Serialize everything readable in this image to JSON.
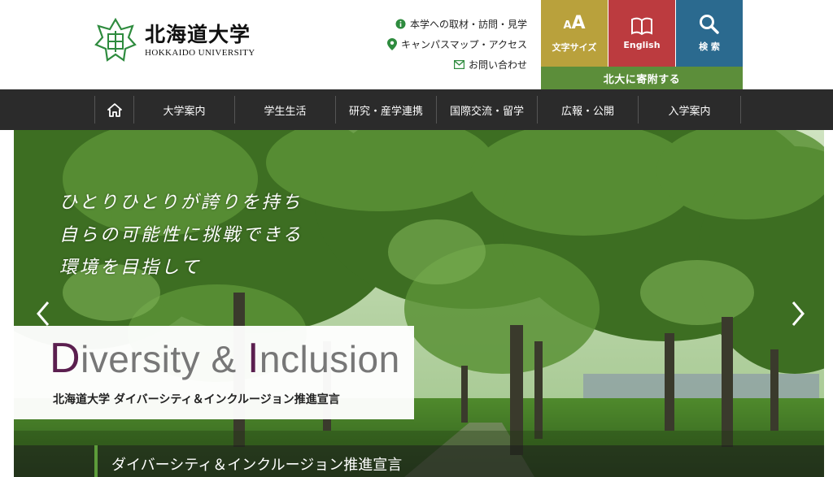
{
  "header": {
    "logo_ja": "北海道大学",
    "logo_en": "HOKKAIDO UNIVERSITY",
    "util_links": [
      {
        "label": "本学への取材・訪問・見学",
        "icon": "info-icon"
      },
      {
        "label": "キャンパスマップ・アクセス",
        "icon": "map-pin-icon"
      },
      {
        "label": "お問い合わせ",
        "icon": "mail-icon"
      }
    ],
    "tiles": {
      "size_label": "文字サイズ",
      "size_glyph_small": "A",
      "size_glyph_big": "A",
      "english_label": "English",
      "search_label": "検 索"
    },
    "donate_label": "北大に寄附する"
  },
  "nav": {
    "items": [
      "大学案内",
      "学生生活",
      "研究・産学連携",
      "国際交流・留学",
      "広報・公開",
      "入学案内"
    ]
  },
  "hero": {
    "tagline": [
      "ひとりひとりが誇りを持ち",
      "自らの可能性に挑戦できる",
      "環境を目指して"
    ],
    "di_cap1": "D",
    "di_rest1": "iversity & ",
    "di_cap2": "I",
    "di_rest2": "nclusion",
    "di_subtitle": "北海道大学 ダイバーシティ＆インクルージョン推進宣言",
    "caption": "ダイバーシティ＆インクルージョン推進宣言"
  },
  "colors": {
    "size_tile": "#b9a13c",
    "english_tile": "#bc3b3f",
    "search_tile": "#2b6a8f",
    "donate_bar": "#5c8e3a",
    "nav_bg": "#2b2b2b",
    "accent_green": "#2e8b3e",
    "di_purple": "#5b1f4f"
  }
}
